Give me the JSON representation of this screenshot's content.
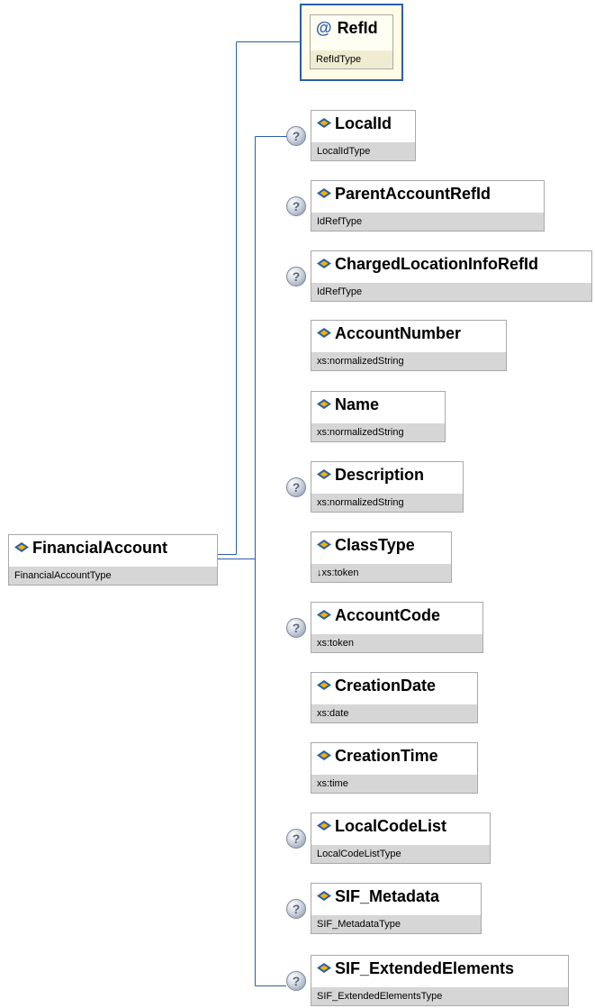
{
  "root": {
    "name": "FinancialAccount",
    "type": "FinancialAccountType",
    "icon": "element-icon"
  },
  "attribute": {
    "name": "RefId",
    "type": "RefIdType",
    "icon": "attribute-icon",
    "symbol": "@"
  },
  "children": [
    {
      "name": "LocalId",
      "type": "LocalIdType",
      "optional": true
    },
    {
      "name": "ParentAccountRefId",
      "type": "IdRefType",
      "optional": true
    },
    {
      "name": "ChargedLocationInfoRefId",
      "type": "IdRefType",
      "optional": true
    },
    {
      "name": "AccountNumber",
      "type": "xs:normalizedString",
      "optional": false
    },
    {
      "name": "Name",
      "type": "xs:normalizedString",
      "optional": false
    },
    {
      "name": "Description",
      "type": "xs:normalizedString",
      "optional": true
    },
    {
      "name": "ClassType",
      "type": "↓xs:token",
      "optional": false
    },
    {
      "name": "AccountCode",
      "type": "xs:token",
      "optional": true
    },
    {
      "name": "CreationDate",
      "type": "xs:date",
      "optional": false
    },
    {
      "name": "CreationTime",
      "type": "xs:time",
      "optional": false
    },
    {
      "name": "LocalCodeList",
      "type": "LocalCodeListType",
      "optional": true
    },
    {
      "name": "SIF_Metadata",
      "type": "SIF_MetadataType",
      "optional": true
    },
    {
      "name": "SIF_ExtendedElements",
      "type": "SIF_ExtendedElementsType",
      "optional": true
    }
  ],
  "optional_marker": "?",
  "colors": {
    "connector": "#2d5ea8",
    "type_band": "#d6d6d6",
    "border": "#a9a9a9",
    "diamond": "#2d5ea8",
    "diamond_accent": "#f0b400"
  }
}
